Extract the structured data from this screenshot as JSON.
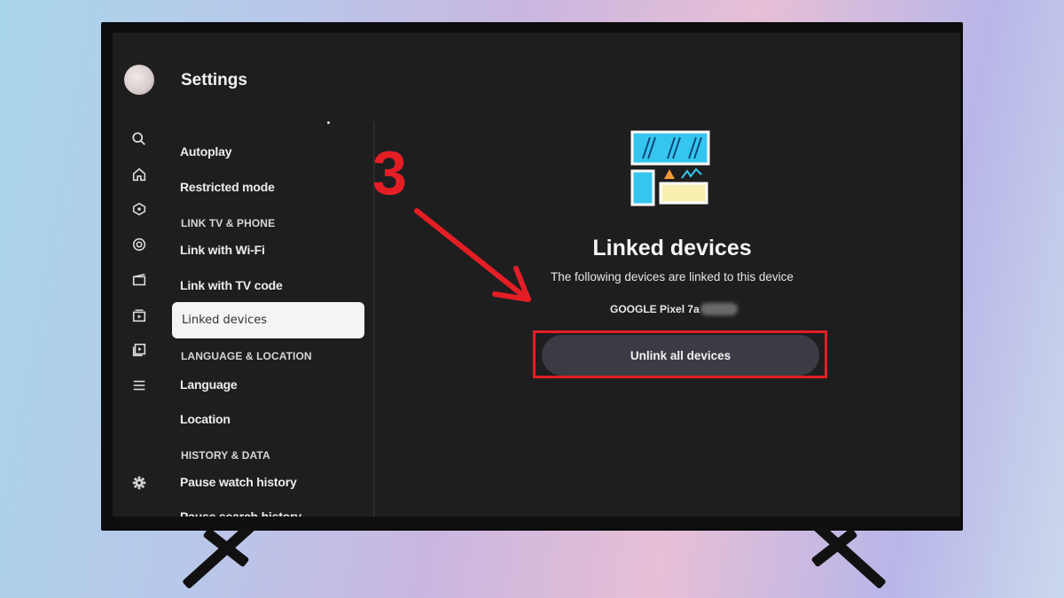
{
  "screen": {
    "title": "Settings",
    "menu": {
      "items": [
        {
          "type": "item",
          "label": "Autoplay"
        },
        {
          "type": "item",
          "label": "Restricted mode"
        },
        {
          "type": "section",
          "label": "LINK TV & PHONE"
        },
        {
          "type": "item",
          "label": "Link with Wi-Fi"
        },
        {
          "type": "item",
          "label": "Link with TV code"
        },
        {
          "type": "selected",
          "label": "Linked devices"
        },
        {
          "type": "section",
          "label": "LANGUAGE & LOCATION"
        },
        {
          "type": "item",
          "label": "Language"
        },
        {
          "type": "item",
          "label": "Location"
        },
        {
          "type": "section",
          "label": "HISTORY & DATA"
        },
        {
          "type": "item",
          "label": "Pause watch history"
        },
        {
          "type": "item",
          "label": "Pause search history"
        }
      ]
    },
    "rail_icons": [
      "search-icon",
      "home-icon",
      "explore-icon",
      "live-icon",
      "movies-icon",
      "subscriptions-icon",
      "library-icon",
      "menu-icon",
      "gear-icon"
    ],
    "panel": {
      "title": "Linked devices",
      "subtitle": "The following devices are linked to this device",
      "device_name": "GOOGLE Pixel 7a",
      "button_label": "Unlink all devices"
    }
  },
  "annotation": {
    "step_number": "3",
    "color": "#e51e25"
  }
}
